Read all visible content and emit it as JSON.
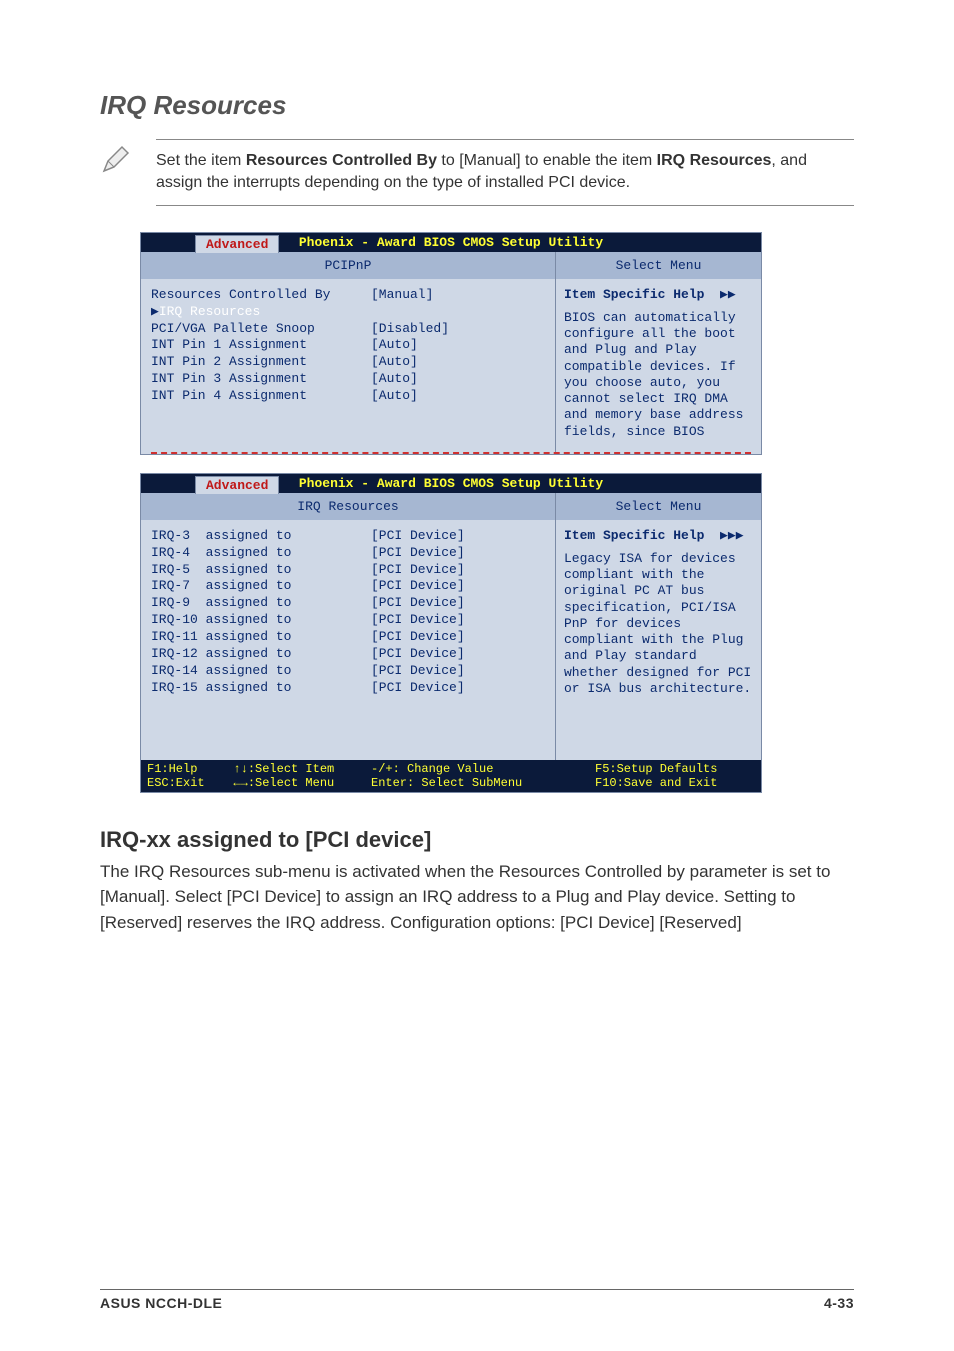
{
  "title": "IRQ Resources",
  "note": {
    "pre": "Set the item ",
    "b1": "Resources Controlled By",
    "mid": " to [Manual] to enable the item ",
    "b2": "IRQ Resources",
    "post": ", and assign the interrupts depending on the type of installed PCI device."
  },
  "bios_title": "Phoenix - Award BIOS CMOS Setup Utility",
  "bios_tab": "Advanced",
  "bios1": {
    "left_header": "PCIPnP",
    "right_header": "Select Menu",
    "rows": [
      {
        "label": "Resources Controlled By",
        "val": "[Manual]",
        "sel": false
      },
      {
        "label": "IRQ Resources",
        "val": "",
        "sel": true,
        "submenu": true
      },
      {
        "label": "",
        "val": ""
      },
      {
        "label": "PCI/VGA Pallete Snoop",
        "val": "[Disabled]"
      },
      {
        "label": "INT Pin 1 Assignment",
        "val": "[Auto]"
      },
      {
        "label": "INT Pin 2 Assignment",
        "val": "[Auto]"
      },
      {
        "label": "INT Pin 3 Assignment",
        "val": "[Auto]"
      },
      {
        "label": "INT Pin 4 Assignment",
        "val": "[Auto]"
      }
    ],
    "help_title": "Item Specific Help",
    "help_text": "BIOS can automatically configure all the boot and Plug and Play compatible devices. If you choose auto, you cannot select IRQ DMA and memory base address fields, since BIOS"
  },
  "bios2": {
    "left_header": "IRQ Resources",
    "right_header": "Select Menu",
    "rows": [
      {
        "label": "IRQ-3  assigned to",
        "val": "[PCI Device]"
      },
      {
        "label": "IRQ-4  assigned to",
        "val": "[PCI Device]"
      },
      {
        "label": "IRQ-5  assigned to",
        "val": "[PCI Device]"
      },
      {
        "label": "IRQ-7  assigned to",
        "val": "[PCI Device]"
      },
      {
        "label": "IRQ-9  assigned to",
        "val": "[PCI Device]"
      },
      {
        "label": "IRQ-10 assigned to",
        "val": "[PCI Device]"
      },
      {
        "label": "IRQ-11 assigned to",
        "val": "[PCI Device]"
      },
      {
        "label": "IRQ-12 assigned to",
        "val": "[PCI Device]"
      },
      {
        "label": "IRQ-14 assigned to",
        "val": "[PCI Device]"
      },
      {
        "label": "IRQ-15 assigned to",
        "val": "[PCI Device]"
      }
    ],
    "help_title": "Item Specific Help",
    "help_text": "Legacy ISA for devices compliant with the original PC AT bus specification, PCI/ISA PnP for devices compliant with the Plug and Play standard whether designed for PCI or ISA bus architecture.",
    "footer": {
      "c1": "F1:Help     ↑↓:Select Item",
      "c2": "-/+: Change Value",
      "c3": "F5:Setup Defaults",
      "c4": "ESC:Exit    ←→:Select Menu",
      "c5": "Enter: Select SubMenu",
      "c6": "F10:Save and Exit"
    }
  },
  "section_heading": "IRQ-xx assigned to [PCI device]",
  "section_body": "The IRQ Resources sub-menu is activated when the Resources Controlled by parameter is set to [Manual]. Select [PCI Device] to assign an IRQ address to a Plug and Play device. Setting to [Reserved] reserves the IRQ address. Configuration options: [PCI Device] [Reserved]",
  "footer_left": "ASUS NCCH-DLE",
  "footer_right": "4-33"
}
